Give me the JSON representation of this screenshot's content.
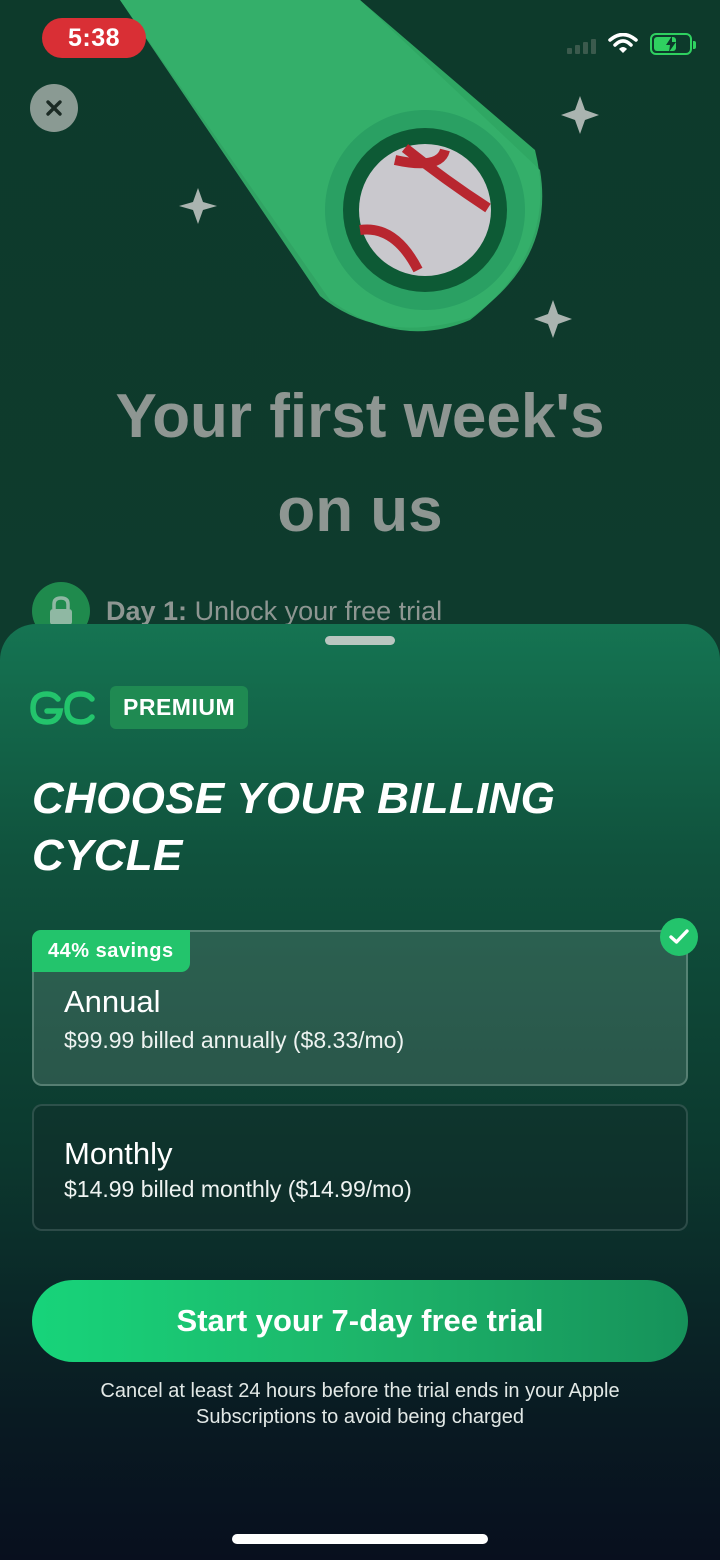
{
  "status_bar": {
    "time": "5:38",
    "wifi_icon": "wifi-icon",
    "battery_icon": "battery-charging-icon",
    "accent_color": "#d92f35"
  },
  "header": {
    "close_icon": "close-icon"
  },
  "hero": {
    "title_line1": "Your first week's",
    "title_line2": "on us",
    "icon": "baseball-comet-icon"
  },
  "timeline": {
    "day_label": "Day 1:",
    "day_text": "Unlock your free trial",
    "icon": "lock-icon"
  },
  "sheet": {
    "brand_logo_text": "GC",
    "badge": "PREMIUM",
    "title": "CHOOSE YOUR BILLING CYCLE",
    "plans": [
      {
        "name": "Annual",
        "price": "$99.99 billed annually ($8.33/mo)",
        "badge": "44% savings",
        "selected": true
      },
      {
        "name": "Monthly",
        "price": "$14.99 billed monthly ($14.99/mo)",
        "selected": false
      }
    ],
    "cta": "Start your 7-day free trial",
    "fineprint": "Cancel at least 24 hours before the trial ends in your Apple Subscriptions to avoid being charged"
  },
  "colors": {
    "brand_green": "#23c46c",
    "background": "#0f3c2e"
  }
}
